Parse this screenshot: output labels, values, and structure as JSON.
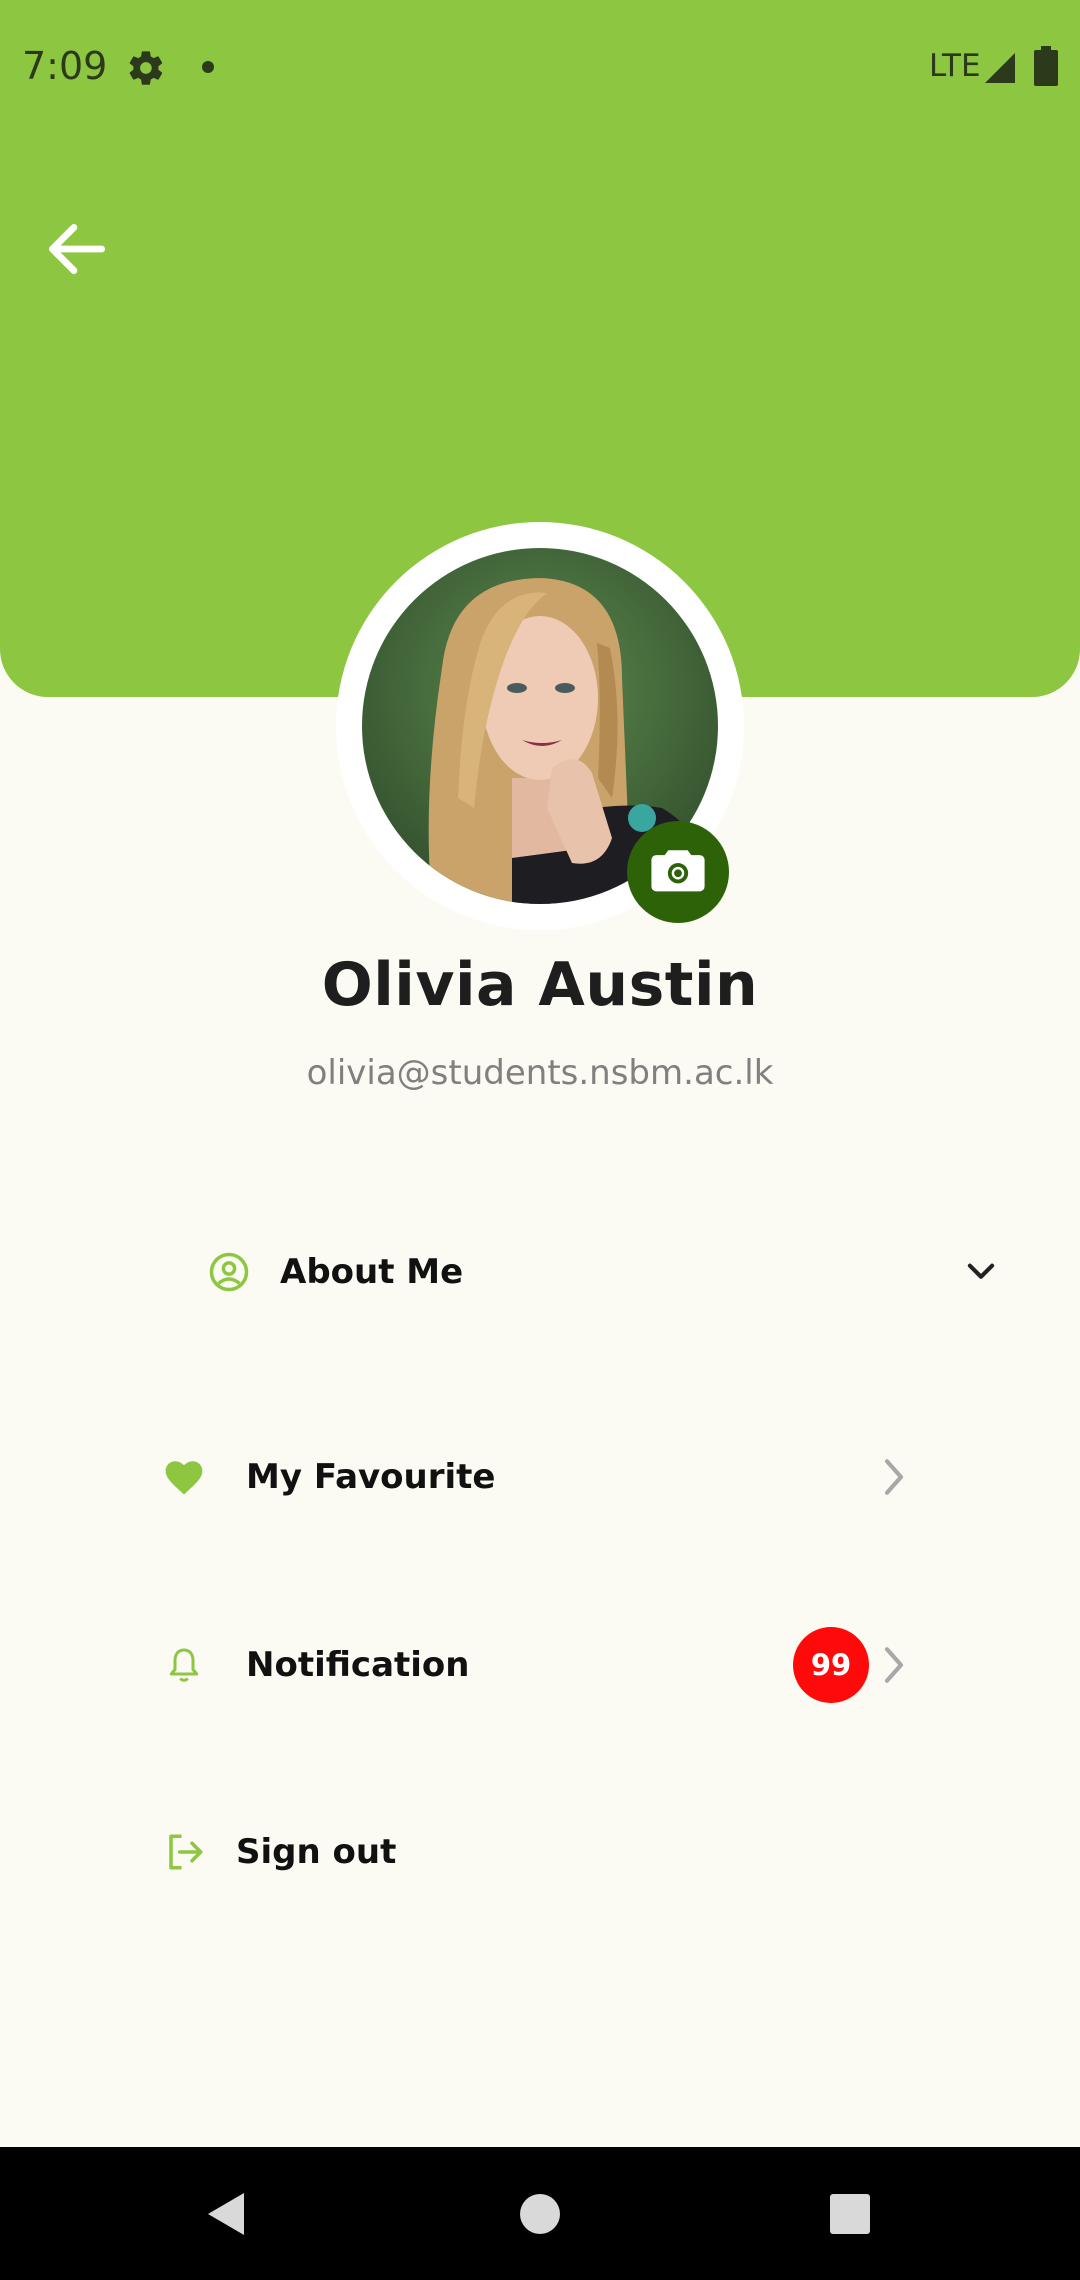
{
  "status_bar": {
    "time": "7:09",
    "network": "LTE",
    "icons": [
      "gear-icon",
      "dot-icon",
      "signal-icon",
      "battery-icon"
    ]
  },
  "header": {
    "back_icon": "arrow-left-icon",
    "accent_color": "#8DC641"
  },
  "profile": {
    "name": "Olivia Austin",
    "email": "olivia@students.nsbm.ac.lk",
    "camera_icon": "camera-icon",
    "camera_button_color": "#2E6208"
  },
  "menu": {
    "about": {
      "label": "About Me",
      "icon": "user-circle-icon",
      "trailing_icon": "chevron-down-icon"
    },
    "favourite": {
      "label": "My Favourite",
      "icon": "heart-icon",
      "trailing_icon": "chevron-right-icon"
    },
    "notification": {
      "label": "Notification",
      "icon": "bell-icon",
      "badge": "99",
      "badge_color": "#FF0A0A",
      "trailing_icon": "chevron-right-icon"
    },
    "signout": {
      "label": "Sign out",
      "icon": "sign-out-icon"
    }
  },
  "nav_bar": {
    "icons": [
      "back-triangle-icon",
      "home-circle-icon",
      "recents-square-icon"
    ]
  }
}
